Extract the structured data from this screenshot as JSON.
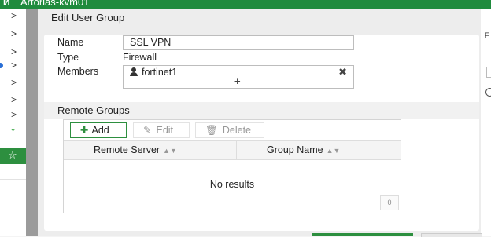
{
  "topbar": {
    "logo": "И",
    "hostname": "Artorias-kvm01"
  },
  "sidebar": {
    "items": [
      {
        "glyph": ">"
      },
      {
        "glyph": ">"
      },
      {
        "glyph": ">"
      },
      {
        "glyph": ">"
      },
      {
        "glyph": ">"
      },
      {
        "glyph": ">"
      },
      {
        "glyph": ">"
      },
      {
        "glyph": "⌄"
      }
    ],
    "active_glyph": "☆"
  },
  "dialog": {
    "title": "Edit User Group",
    "fields": {
      "name_label": "Name",
      "name_value": "SSL VPN",
      "type_label": "Type",
      "type_value": "Firewall",
      "members_label": "Members",
      "members": [
        "fortinet1"
      ],
      "add_member_glyph": "+",
      "remove_glyph": "✖"
    },
    "remote_groups": {
      "section_title": "Remote Groups",
      "toolbar": {
        "add_label": "Add",
        "edit_label": "Edit",
        "delete_label": "Delete"
      },
      "columns": [
        "Remote Server",
        "Group Name"
      ],
      "sort_glyph": "▲▼",
      "empty_text": "No results",
      "count": "0"
    }
  },
  "right_edge": {
    "partial_text": "F"
  },
  "colors": {
    "brand_green": "#2d8f3f",
    "topbar_green": "#1f8b3d",
    "link_blue": "#2a6fd6"
  }
}
